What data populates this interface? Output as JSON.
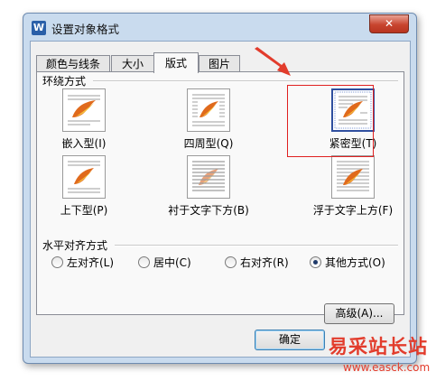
{
  "window": {
    "title": "设置对象格式",
    "app_icon_letter": "W",
    "close_glyph": "✕"
  },
  "tabs": [
    {
      "label": "颜色与线条",
      "active": false
    },
    {
      "label": "大小",
      "active": false
    },
    {
      "label": "版式",
      "active": true
    },
    {
      "label": "图片",
      "active": false
    }
  ],
  "wrap_section": {
    "title": "环绕方式",
    "options": [
      {
        "label": "嵌入型(I)",
        "icon": "inline-icon",
        "selected": false
      },
      {
        "label": "四周型(Q)",
        "icon": "square-wrap-icon",
        "selected": false
      },
      {
        "label": "紧密型(T)",
        "icon": "tight-wrap-icon",
        "selected": true
      },
      {
        "label": "上下型(P)",
        "icon": "top-bottom-icon",
        "selected": false
      },
      {
        "label": "衬于文字下方(B)",
        "icon": "behind-text-icon",
        "selected": false
      },
      {
        "label": "浮于文字上方(F)",
        "icon": "in-front-of-text-icon",
        "selected": false
      }
    ]
  },
  "align_section": {
    "title": "水平对齐方式",
    "options": [
      {
        "label": "左对齐(L)",
        "checked": false
      },
      {
        "label": "居中(C)",
        "checked": false
      },
      {
        "label": "右对齐(R)",
        "checked": false
      },
      {
        "label": "其他方式(O)",
        "checked": true
      }
    ]
  },
  "buttons": {
    "advanced": "高级(A)...",
    "ok": "确定"
  },
  "watermark": {
    "title": "易采站长站",
    "url": "www.easck.com"
  },
  "colors": {
    "highlight": "#e02020",
    "arrow": "#e23c2c",
    "selected_tile": "#2f4f9f"
  }
}
